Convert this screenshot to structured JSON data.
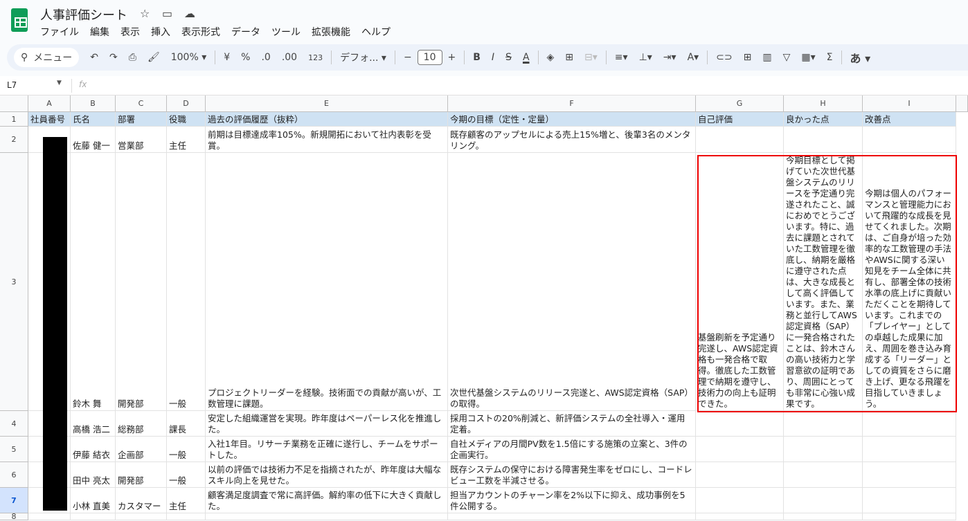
{
  "doc": {
    "title": "人事評価シート"
  },
  "menu": [
    "ファイル",
    "編集",
    "表示",
    "挿入",
    "表示形式",
    "データ",
    "ツール",
    "拡張機能",
    "ヘルプ"
  ],
  "toolbar": {
    "search": "メニュー",
    "zoom": "100%",
    "currency": "¥",
    "percent": "%",
    "dec_minus": ".0",
    "dec_plus": ".00",
    "number_format": "123",
    "font": "デフォ...",
    "font_size": "10",
    "bold": "B",
    "italic": "I",
    "input_tools": "あ"
  },
  "formula_bar": {
    "cell_ref": "L7",
    "fx": "fx",
    "value": ""
  },
  "columns": [
    "A",
    "B",
    "C",
    "D",
    "E",
    "F",
    "G",
    "H",
    "I"
  ],
  "rows": [
    "1",
    "2",
    "3",
    "4",
    "5",
    "6",
    "7",
    "8"
  ],
  "header": [
    "社員番号",
    "氏名",
    "部署",
    "役職",
    "過去の評価履歴（抜粋）",
    "今期の目標（定性・定量）",
    "自己評価",
    "良かった点",
    "改善点"
  ],
  "data": [
    [
      "",
      "佐藤 健一",
      "営業部",
      "主任",
      "前期は目標達成率105%。新規開拓において社内表彰を受賞。",
      "既存顧客のアップセルによる売上15%増と、後輩3名のメンタリング。",
      "",
      "",
      ""
    ],
    [
      "",
      "鈴木 舞",
      "開発部",
      "一般",
      "プロジェクトリーダーを経験。技術面での貢献が高いが、工数管理に課題。",
      "次世代基盤システムのリリース完遂と、AWS認定資格（SAP）の取得。",
      "基盤刷新を予定通り完遂し、AWS認定資格も一発合格で取得。徹底した工数管理で納期を遵守し、技術力の向上も証明できた。",
      "今期目標として掲げていた次世代基盤システムのリリースを予定通り完遂されたこと、誠におめでとうございます。特に、過去に課題とされていた工数管理を徹底し、納期を厳格に遵守された点は、大きな成長として高く評価しています。また、業務と並行してAWS認定資格（SAP）に一発合格されたことは、鈴木さんの高い技術力と学習意欲の証明であり、周囲にとっても非常に心強い成果です。",
      "今期は個人のパフォーマンスと管理能力において飛躍的な成長を見せてくれました。次期は、ご自身が培った効率的な工数管理の手法やAWSに関する深い知見をチーム全体に共有し、部署全体の技術水準の底上げに貢献いただくことを期待しています。これまでの「プレイヤー」としての卓越した成果に加え、周囲を巻き込み育成する「リーダー」としての資質をさらに磨き上げ、更なる飛躍を目指していきましょう。"
    ],
    [
      "",
      "高橋 浩二",
      "総務部",
      "課長",
      "安定した組織運営を実現。昨年度はペーパーレス化を推進した。",
      "採用コストの20%削減と、新評価システムの全社導入・運用定着。",
      "",
      "",
      ""
    ],
    [
      "",
      "伊藤 結衣",
      "企画部",
      "一般",
      "入社1年目。リサーチ業務を正確に遂行し、チームをサポートした。",
      "自社メディアの月間PV数を1.5倍にする施策の立案と、3件の企画実行。",
      "",
      "",
      ""
    ],
    [
      "",
      "田中 亮太",
      "開発部",
      "一般",
      "以前の評価では技術力不足を指摘されたが、昨年度は大幅なスキル向上を見せた。",
      "既存システムの保守における障害発生率をゼロにし、コードレビュー工数を半減させる。",
      "",
      "",
      ""
    ],
    [
      "",
      "小林 直美",
      "カスタマー",
      "主任",
      "顧客満足度調査で常に高評価。解約率の低下に大きく貢献した。",
      "担当アカウントのチャーン率を2%以下に抑え、成功事例を5件公開する。",
      "",
      "",
      ""
    ]
  ],
  "colors": {
    "header_fill": "#cfe2f3",
    "highlight": "#ee0000",
    "brand": "#0f9d58"
  }
}
